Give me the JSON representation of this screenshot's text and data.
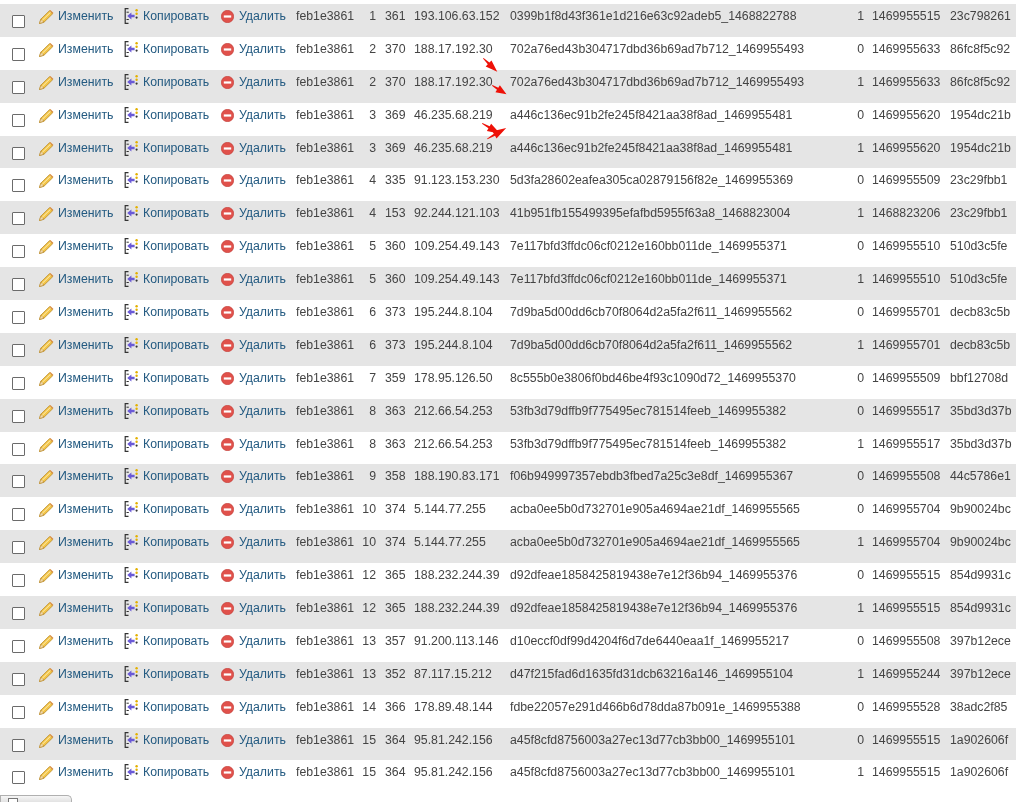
{
  "table": {
    "rows": [
      {
        "checked": false,
        "kind": "plain",
        "edit": "Изменить",
        "copy": "Копировать",
        "delete": "Удалить",
        "cells": [
          "feb1e3861",
          "1",
          "361",
          "193.106.63.152",
          "0399b1f8d43f361e1d216e63c92adeb5_1468822788",
          "1",
          "1469955515",
          "23c798261"
        ]
      },
      {
        "checked": false,
        "kind": "plain",
        "edit": "Изменить",
        "copy": "Копировать",
        "delete": "Удалить",
        "cells": [
          "feb1e3861",
          "2",
          "370",
          "188.17.192.30",
          "702a76ed43b304717dbd36b69ad7b712_1469955493",
          "0",
          "1469955633",
          "86fc8f5c92"
        ]
      },
      {
        "checked": false,
        "kind": "split",
        "edit": "Изменить",
        "copy": "Копировать",
        "delete": "Удалить",
        "cells": [
          "feb1e3861",
          "2",
          "370",
          "188.17.192.30",
          "702a76ed43b304717dbd36b69ad7b712_1469955493",
          "1",
          "1469955633",
          "86fc8f5c92"
        ]
      },
      {
        "checked": false,
        "kind": "plain",
        "edit": "Изменить",
        "copy": "Копировать",
        "delete": "Удалить",
        "cells": [
          "feb1e3861",
          "3",
          "369",
          "46.235.68.219",
          "a446c136ec91b2fe245f8421aa38f8ad_1469955481",
          "0",
          "1469955620",
          "1954dc21b"
        ]
      },
      {
        "checked": false,
        "kind": "converging",
        "edit": "Изменить",
        "copy": "Копировать",
        "delete": "Удалить",
        "cells": [
          "feb1e3861",
          "3",
          "369",
          "46.235.68.219",
          "a446c136ec91b2fe245f8421aa38f8ad_1469955481",
          "1",
          "1469955620",
          "1954dc21b"
        ]
      },
      {
        "checked": false,
        "kind": "plain",
        "edit": "Изменить",
        "copy": "Копировать",
        "delete": "Удалить",
        "cells": [
          "feb1e3861",
          "4",
          "335",
          "91.123.153.230",
          "5d3fa28602eafea305ca02879156f82e_1469955369",
          "0",
          "1469955509",
          "23c29fbb1"
        ]
      },
      {
        "checked": false,
        "kind": "plain",
        "edit": "Изменить",
        "copy": "Копировать",
        "delete": "Удалить",
        "cells": [
          "feb1e3861",
          "4",
          "153",
          "92.244.121.103",
          "41b951fb155499395efafbd5955f63a8_1468823004",
          "1",
          "1468823206",
          "23c29fbb1"
        ]
      },
      {
        "checked": false,
        "kind": "plain",
        "edit": "Изменить",
        "copy": "Копировать",
        "delete": "Удалить",
        "cells": [
          "feb1e3861",
          "5",
          "360",
          "109.254.49.143",
          "7e117bfd3ffdc06cf0212e160bb011de_1469955371",
          "0",
          "1469955510",
          "510d3c5fe"
        ]
      },
      {
        "checked": false,
        "kind": "plain",
        "edit": "Изменить",
        "copy": "Копировать",
        "delete": "Удалить",
        "cells": [
          "feb1e3861",
          "5",
          "360",
          "109.254.49.143",
          "7e117bfd3ffdc06cf0212e160bb011de_1469955371",
          "1",
          "1469955510",
          "510d3c5fe"
        ]
      },
      {
        "checked": false,
        "kind": "plain",
        "edit": "Изменить",
        "copy": "Копировать",
        "delete": "Удалить",
        "cells": [
          "feb1e3861",
          "6",
          "373",
          "195.244.8.104",
          "7d9ba5d00dd6cb70f8064d2a5fa2f611_1469955562",
          "0",
          "1469955701",
          "decb83c5b"
        ]
      },
      {
        "checked": false,
        "kind": "plain",
        "edit": "Изменить",
        "copy": "Копировать",
        "delete": "Удалить",
        "cells": [
          "feb1e3861",
          "6",
          "373",
          "195.244.8.104",
          "7d9ba5d00dd6cb70f8064d2a5fa2f611_1469955562",
          "1",
          "1469955701",
          "decb83c5b"
        ]
      },
      {
        "checked": false,
        "kind": "plain",
        "edit": "Изменить",
        "copy": "Копировать",
        "delete": "Удалить",
        "cells": [
          "feb1e3861",
          "7",
          "359",
          "178.95.126.50",
          "8c555b0e3806f0bd46be4f93c1090d72_1469955370",
          "0",
          "1469955509",
          "bbf12708d"
        ]
      },
      {
        "checked": false,
        "kind": "plain",
        "edit": "Изменить",
        "copy": "Копировать",
        "delete": "Удалить",
        "cells": [
          "feb1e3861",
          "8",
          "363",
          "212.66.54.253",
          "53fb3d79dffb9f775495ec781514feeb_1469955382",
          "0",
          "1469955517",
          "35bd3d37b"
        ]
      },
      {
        "checked": false,
        "kind": "plain",
        "edit": "Изменить",
        "copy": "Копировать",
        "delete": "Удалить",
        "cells": [
          "feb1e3861",
          "8",
          "363",
          "212.66.54.253",
          "53fb3d79dffb9f775495ec781514feeb_1469955382",
          "1",
          "1469955517",
          "35bd3d37b"
        ]
      },
      {
        "checked": false,
        "kind": "plain",
        "edit": "Изменить",
        "copy": "Копировать",
        "delete": "Удалить",
        "cells": [
          "feb1e3861",
          "9",
          "358",
          "188.190.83.171",
          "f06b949997357ebdb3fbed7a25c3e8df_1469955367",
          "0",
          "1469955508",
          "44c5786e1"
        ]
      },
      {
        "checked": false,
        "kind": "plain",
        "edit": "Изменить",
        "copy": "Копировать",
        "delete": "Удалить",
        "cells": [
          "feb1e3861",
          "10",
          "374",
          "5.144.77.255",
          "acba0ee5b0d732701e905a4694ae21df_1469955565",
          "0",
          "1469955704",
          "9b90024bc"
        ]
      },
      {
        "checked": false,
        "kind": "plain",
        "edit": "Изменить",
        "copy": "Копировать",
        "delete": "Удалить",
        "cells": [
          "feb1e3861",
          "10",
          "374",
          "5.144.77.255",
          "acba0ee5b0d732701e905a4694ae21df_1469955565",
          "1",
          "1469955704",
          "9b90024bc"
        ]
      },
      {
        "checked": false,
        "kind": "plain",
        "edit": "Изменить",
        "copy": "Копировать",
        "delete": "Удалить",
        "cells": [
          "feb1e3861",
          "12",
          "365",
          "188.232.244.39",
          "d92dfeae1858425819438e7e12f36b94_1469955376",
          "0",
          "1469955515",
          "854d9931c"
        ]
      },
      {
        "checked": false,
        "kind": "plain",
        "edit": "Изменить",
        "copy": "Копировать",
        "delete": "Удалить",
        "cells": [
          "feb1e3861",
          "12",
          "365",
          "188.232.244.39",
          "d92dfeae1858425819438e7e12f36b94_1469955376",
          "1",
          "1469955515",
          "854d9931c"
        ]
      },
      {
        "checked": false,
        "kind": "plain",
        "edit": "Изменить",
        "copy": "Копировать",
        "delete": "Удалить",
        "cells": [
          "feb1e3861",
          "13",
          "357",
          "91.200.113.146",
          "d10eccf0df99d4204f6d7de6440eaa1f_1469955217",
          "0",
          "1469955508",
          "397b12ece"
        ]
      },
      {
        "checked": false,
        "kind": "plain",
        "edit": "Изменить",
        "copy": "Копировать",
        "delete": "Удалить",
        "cells": [
          "feb1e3861",
          "13",
          "352",
          "87.117.15.212",
          "d47f215fad6d1635fd31dcb63216a146_1469955104",
          "1",
          "1469955244",
          "397b12ece"
        ]
      },
      {
        "checked": false,
        "kind": "plain",
        "edit": "Изменить",
        "copy": "Копировать",
        "delete": "Удалить",
        "cells": [
          "feb1e3861",
          "14",
          "366",
          "178.89.48.144",
          "fdbe22057e291d466b6d78dda87b091e_1469955388",
          "0",
          "1469955528",
          "38adc2f85"
        ]
      },
      {
        "checked": false,
        "kind": "plain",
        "edit": "Изменить",
        "copy": "Копировать",
        "delete": "Удалить",
        "cells": [
          "feb1e3861",
          "15",
          "364",
          "95.81.242.156",
          "a45f8cfd8756003a27ec13d77cb3bb00_1469955101",
          "0",
          "1469955515",
          "1a902606f"
        ]
      },
      {
        "checked": false,
        "kind": "plain",
        "edit": "Изменить",
        "copy": "Копировать",
        "delete": "Удалить",
        "cells": [
          "feb1e3861",
          "15",
          "364",
          "95.81.242.156",
          "a45f8cfd8756003a27ec13d77cb3bb00_1469955101",
          "1",
          "1469955515",
          "1a902606f"
        ]
      }
    ]
  },
  "bottom_bar": {
    "checked": false
  }
}
